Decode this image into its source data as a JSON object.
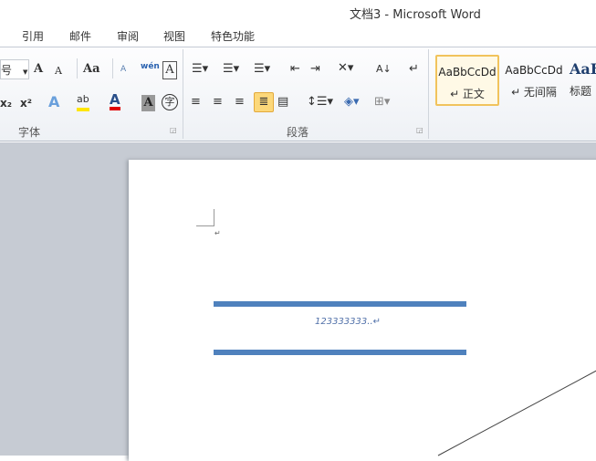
{
  "window": {
    "title": "文档3  -  Microsoft Word"
  },
  "tabs": [
    "引用",
    "邮件",
    "审阅",
    "视图",
    "特色功能"
  ],
  "font_group": {
    "label": "字体",
    "size_fragment": "号",
    "grow": "A",
    "shrink": "A",
    "change_case": "Aa",
    "clear_format": "A",
    "phonetic": "wén",
    "border": "A",
    "subscript": "x₂",
    "superscript": "x²",
    "effects": "A",
    "highlight": "ab",
    "font_color": "A",
    "shading": "A",
    "enclose": "字"
  },
  "paragraph_group": {
    "label": "段落"
  },
  "styles": [
    {
      "preview": "AaBbCcDd",
      "name": "↵ 正文",
      "selected": true
    },
    {
      "preview": "AaBbCcDd",
      "name": "↵ 无间隔",
      "selected": false
    },
    {
      "preview": "AaB",
      "name": "标题",
      "selected": false
    }
  ],
  "document": {
    "paragraph_mark": "↵",
    "line_text": "123333333..↵"
  },
  "colors": {
    "accent": "#4f81bd",
    "highlight": "#ffe600",
    "font_color": "#e00000"
  }
}
